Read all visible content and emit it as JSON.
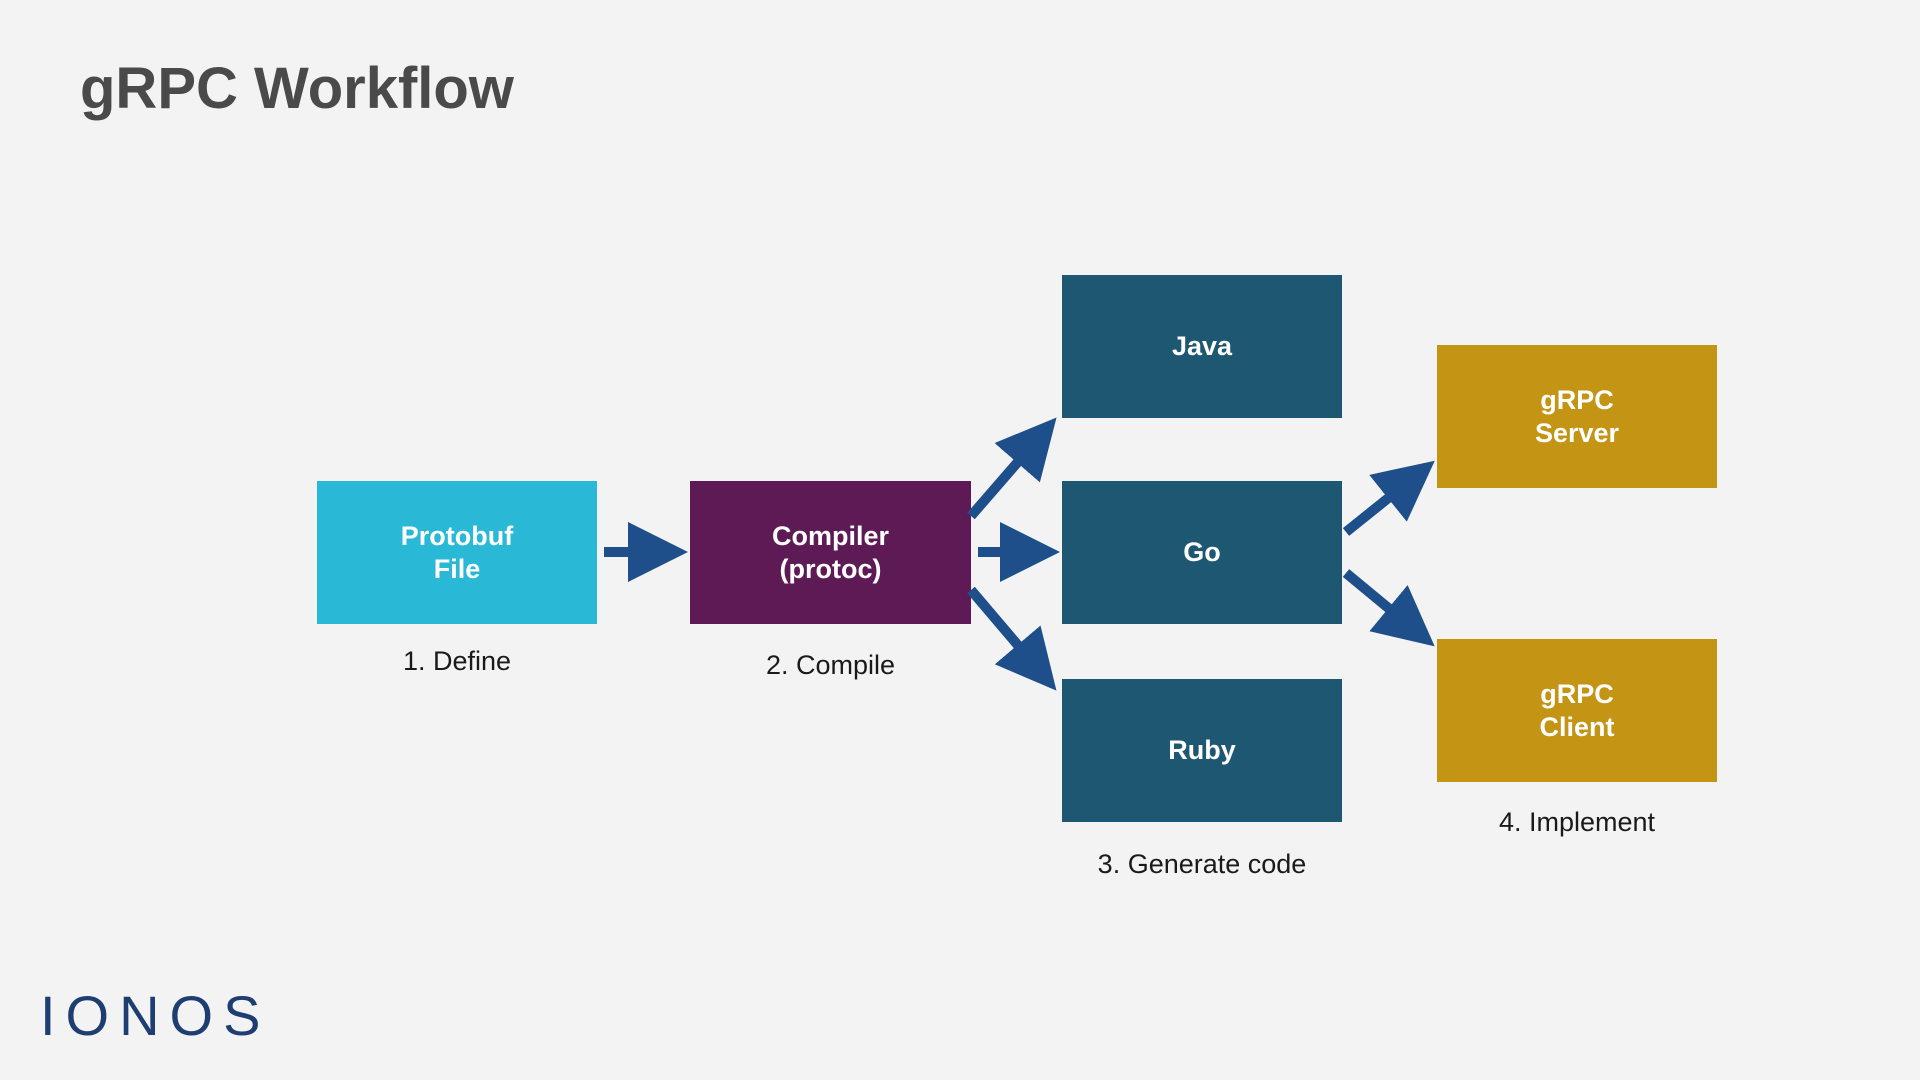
{
  "title": "gRPC Workflow",
  "boxes": {
    "protobuf": {
      "line1": "Protobuf",
      "line2": "File"
    },
    "compiler": {
      "line1": "Compiler",
      "line2": "(protoc)"
    },
    "java": "Java",
    "go": "Go",
    "ruby": "Ruby",
    "server": {
      "line1": "gRPC",
      "line2": "Server"
    },
    "client": {
      "line1": "gRPC",
      "line2": "Client"
    }
  },
  "steps": {
    "s1": "1. Define",
    "s2": "2. Compile",
    "s3": "3. Generate code",
    "s4": "4. Implement"
  },
  "logo": "IONOS",
  "colors": {
    "arrow": "#1e4f8a"
  }
}
